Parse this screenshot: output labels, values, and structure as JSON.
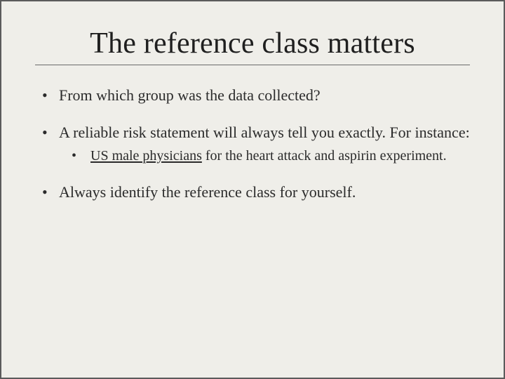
{
  "title": "The reference class matters",
  "bullets": {
    "b1": " From which group was the data collected?",
    "b2_part1": " A reliable risk statement will always tell you exactly. For instance:",
    "b2_sub_underlined": "US male physicians",
    "b2_sub_rest": " for the heart attack and aspirin experiment.",
    "b3": "Always identify the reference class for yourself."
  }
}
